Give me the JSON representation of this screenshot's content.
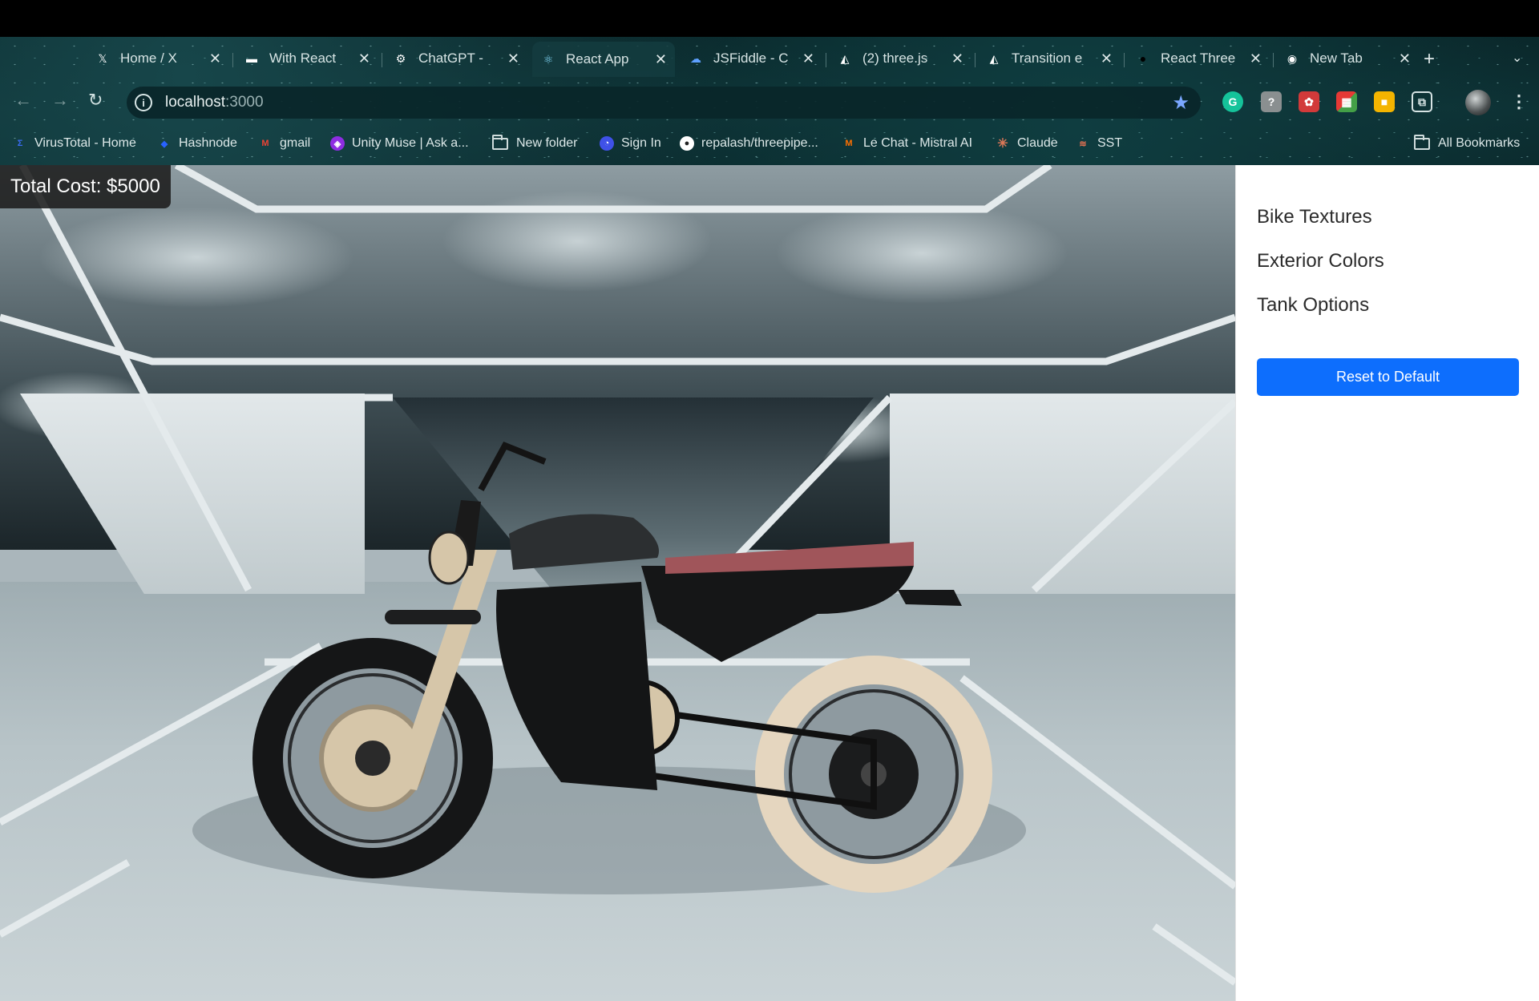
{
  "browser": {
    "tabs": [
      {
        "title": "Home / X",
        "icon": "x-logo-icon",
        "glyph": "𝕏"
      },
      {
        "title": "With React",
        "icon": "site-icon",
        "glyph": "▬"
      },
      {
        "title": "ChatGPT -",
        "icon": "chatgpt-icon",
        "glyph": "⚙"
      },
      {
        "title": "React App",
        "icon": "react-icon",
        "glyph": "⚛"
      },
      {
        "title": "JSFiddle - C",
        "icon": "jsfiddle-icon",
        "glyph": "☁"
      },
      {
        "title": "(2) three.js",
        "icon": "threejs-icon",
        "glyph": "◭"
      },
      {
        "title": "Transition e",
        "icon": "threejs-icon",
        "glyph": "◭"
      },
      {
        "title": "React Three",
        "icon": "circle-icon",
        "glyph": "●"
      },
      {
        "title": "New Tab",
        "icon": "chrome-icon",
        "glyph": "◉"
      }
    ],
    "active_tab_index": 3,
    "url_host": "localhost",
    "url_port": ":3000",
    "bookmarks": [
      {
        "label": "VirusTotal - Home",
        "icon": "virustotal-icon",
        "glyph": "Σ",
        "color": "#3b6cf4"
      },
      {
        "label": "Hashnode",
        "icon": "hashnode-icon",
        "glyph": "◆",
        "color": "#2962ff"
      },
      {
        "label": "gmail",
        "icon": "gmail-icon",
        "glyph": "M",
        "color": "#ea4335"
      },
      {
        "label": "Unity Muse | Ask a...",
        "icon": "unity-muse-icon",
        "glyph": "◈",
        "color": "#8e2de2"
      },
      {
        "label": "New folder",
        "icon": "folder-icon",
        "glyph": "",
        "color": ""
      },
      {
        "label": "Sign In",
        "icon": "sign-in-icon",
        "glyph": "◔",
        "color": "#3f51e8"
      },
      {
        "label": "repalash/threepipe...",
        "icon": "github-icon",
        "glyph": "●",
        "color": "#222222"
      },
      {
        "label": "Le Chat - Mistral AI",
        "icon": "mistral-icon",
        "glyph": "M",
        "color": "#ff7000"
      },
      {
        "label": "Claude",
        "icon": "claude-icon",
        "glyph": "✳",
        "color": "#d97757"
      },
      {
        "label": "SST",
        "icon": "sst-icon",
        "glyph": "≋",
        "color": "#e27152"
      }
    ],
    "all_bookmarks_label": "All Bookmarks"
  },
  "app": {
    "total_cost_label": "Total Cost: $5000",
    "sidebar": {
      "items": [
        "Bike Textures",
        "Exterior Colors",
        "Tank Options"
      ],
      "reset_label": "Reset to Default"
    },
    "colors": {
      "accent": "#0d6efd",
      "seat": "#a0555a",
      "tire_wall": "#e5d6bf"
    }
  }
}
